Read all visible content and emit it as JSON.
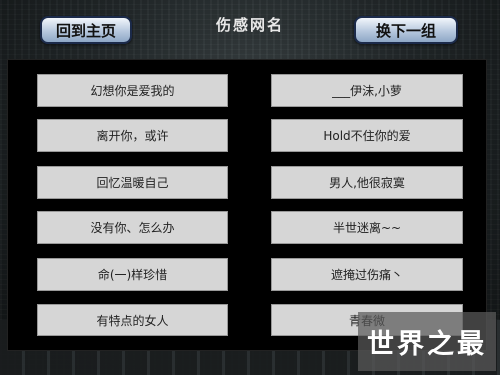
{
  "header": {
    "home_button": "回到主页",
    "title": "伤感网名",
    "next_button": "换下一组"
  },
  "names": {
    "left": [
      "幻想你是爱我的",
      "离开你，或许",
      "回忆温暖自己",
      "没有你、怎么办",
      "命(一)样珍惜",
      "有特点的女人"
    ],
    "right": [
      "___伊沫,小萝",
      "Hold不住你的爱",
      "男人,他很寂寞",
      "半世迷离~~",
      "遮掩过伤痛丶",
      "青春微"
    ]
  },
  "watermark": "世界之最"
}
